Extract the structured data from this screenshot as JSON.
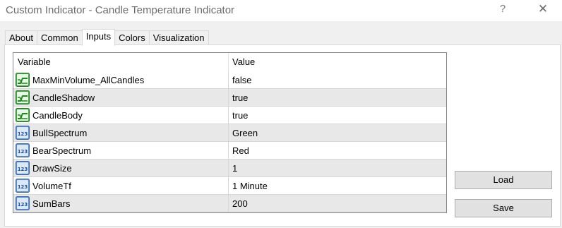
{
  "window": {
    "title": "Custom Indicator - Candle Temperature Indicator",
    "help_glyph": "?",
    "close_glyph": "✕"
  },
  "tabs": [
    {
      "label": "About",
      "active": false
    },
    {
      "label": "Common",
      "active": false
    },
    {
      "label": "Inputs",
      "active": true
    },
    {
      "label": "Colors",
      "active": false
    },
    {
      "label": "Visualization",
      "active": false
    }
  ],
  "inputs": {
    "columns": {
      "variable": "Variable",
      "value": "Value"
    },
    "rows": [
      {
        "variable": "MaxMinVolume_AllCandles",
        "value": "false",
        "icon": "bool-icon"
      },
      {
        "variable": "CandleShadow",
        "value": "true",
        "icon": "bool-icon"
      },
      {
        "variable": "CandleBody",
        "value": "true",
        "icon": "bool-icon"
      },
      {
        "variable": "BullSpectrum",
        "value": "Green",
        "icon": "numeric-icon"
      },
      {
        "variable": "BearSpectrum",
        "value": "Red",
        "icon": "numeric-icon"
      },
      {
        "variable": "DrawSize",
        "value": "1",
        "icon": "numeric-icon"
      },
      {
        "variable": "VolumeTf",
        "value": "1 Minute",
        "icon": "numeric-icon"
      },
      {
        "variable": "SumBars",
        "value": "200",
        "icon": "numeric-icon"
      }
    ]
  },
  "buttons": {
    "load": "Load",
    "save": "Save"
  },
  "colors": {
    "bool_icon_green": "#3dae3d",
    "numeric_icon_blue": "#5b8fd0",
    "row_alt": "#e8e8e8"
  }
}
